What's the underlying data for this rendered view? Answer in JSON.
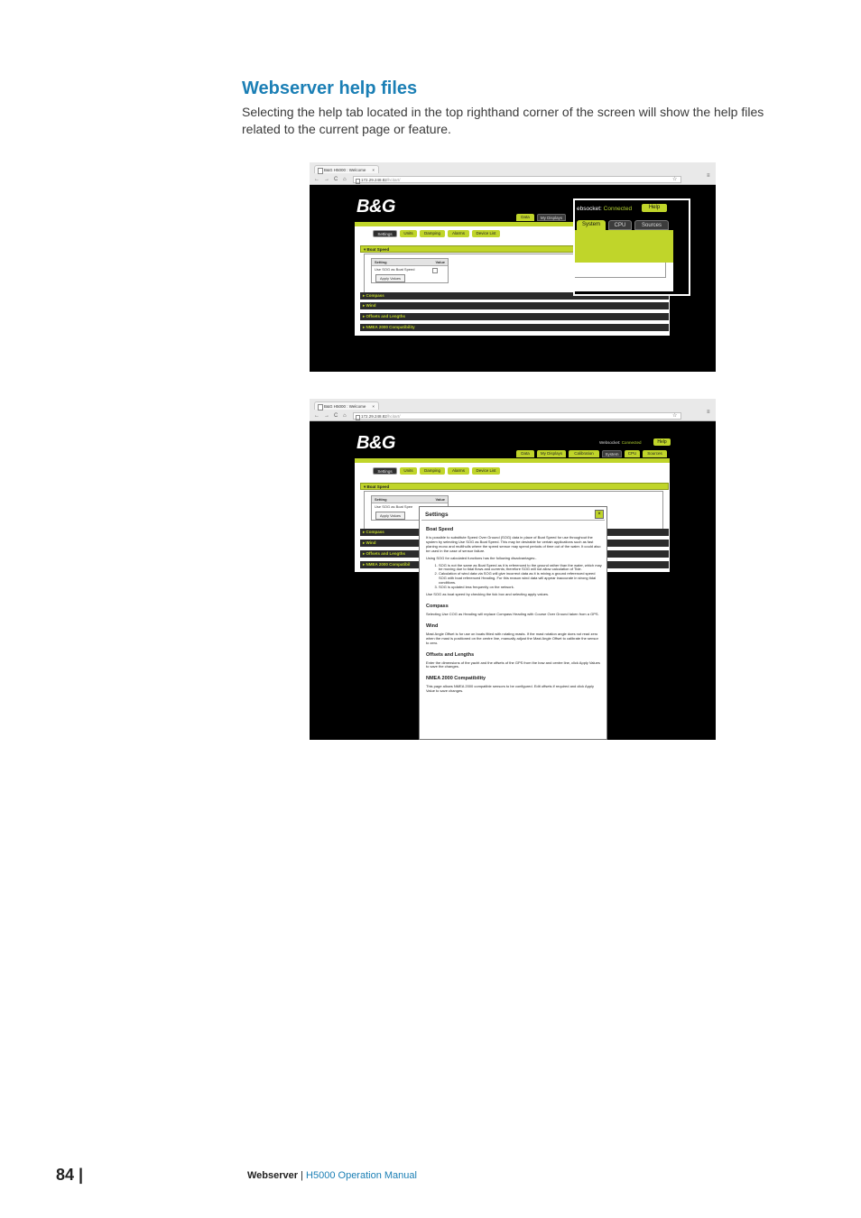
{
  "heading": "Webserver help files",
  "intro": "Selecting the help tab located in the top righthand corner of the screen will show the help files related to the current page or feature.",
  "browser": {
    "tab_title": "B&G H5000 : Welcome",
    "tab_close": "×",
    "back": "←",
    "forward": "→",
    "reload": "C",
    "home": "⌂",
    "star": "☆",
    "menu": "≡"
  },
  "shot1": {
    "url": "172.29.248.82",
    "url_tail": "/hcitart/",
    "logo": "B&G",
    "nav_tabs": [
      "Data",
      "My Displays"
    ],
    "settings_tabs": [
      "Settings",
      "Units",
      "Damping",
      "Alarms",
      "Device List"
    ],
    "sections": [
      "Boat Speed",
      "Compass",
      "Wind",
      "Offsets and Lengths",
      "NMEA 2000 Compatibility"
    ],
    "table": {
      "col1": "Setting",
      "col2": "Value",
      "row1": "Use SOG as Boat Speed",
      "apply": "Apply Values"
    },
    "popup": {
      "ws_label": "ebsocket: ",
      "ws_status": "Connected",
      "help": "Help",
      "tabs": [
        "System",
        "CPU",
        "Sources"
      ]
    }
  },
  "shot2": {
    "url": "172.29.248.82",
    "url_tail": "/hcitart/",
    "logo": "B&G",
    "ws_label": "Websocket: ",
    "ws_status": "Connected",
    "help": "Help",
    "nav_tabs": [
      "Data",
      "My Displays",
      "Calibration",
      "System",
      "CPU",
      "Sources"
    ],
    "settings_tabs": [
      "Settings",
      "Units",
      "Damping",
      "Alarms",
      "Device List"
    ],
    "sections": [
      "Boat Speed",
      "Compass",
      "Wind",
      "Offsets and Lengths",
      "NMEA 2000 Compatibil"
    ],
    "table": {
      "col1": "Setting",
      "col2": "Value",
      "row1": "Use SOG as Boat Spee",
      "apply": "Apply Values"
    },
    "modal": {
      "title": "Settings",
      "close": "×",
      "h_boat": "Boat Speed",
      "p1": "It is possible to substitute Speed Over Ground (SOG) data in place of Boat Speed for use throughout the system by selecting Use SOG as Boat Speed. This may be desirable for certain applications such as fast planing mono and multihulls where the speed sensor may spend periods of time out of the water. It could also be used in the case of sensor failure.",
      "p2": "Using SOG for calculated functions has the following disadvantages:-",
      "li1": "SOG is not the same as Boat Speed as it is referenced to the ground rather than the water, which may be moving due to tidal flows and currents; therefore SOG will not allow calculation of Tide.",
      "li2": "Calculation of wind data via SOG will give incorrect data as it is mixing a ground referenced speed SOG with boat referenced Heading. For this reason wind data will appear inaccurate in strong tidal conditions.",
      "li3": "SOG is updated less frequently on the network.",
      "p3": "Use SOG as boat speed by checking the tick box and selecting apply values.",
      "h_compass": "Compass",
      "p_compass": "Selecting Use COG as Heading will replace Compass Heading with Course Over Ground taken from a GPS.",
      "h_wind": "Wind",
      "p_wind": "Mast Angle Offset is for use on boats fitted with rotating masts. If the mast rotation angle does not read zero when the mast is positioned on the centre line, manually adjust the Mast Angle Offset to calibrate the sensor to zero.",
      "h_offsets": "Offsets and Lengths",
      "p_offsets": "Enter the dimensions of the yacht and the offsets of the GPS from the bow and centre line, click Apply Values to save the changes.",
      "h_nmea": "NMEA 2000 Compatibility",
      "p_nmea": "This page allows NMEA 2000 compatible sensors to be configured. Edit offsets if required and click Apply Value to save changes."
    }
  },
  "footer": {
    "page_number": "84 |",
    "section": "Webserver",
    "sep": " | ",
    "manual": "H5000 Operation Manual"
  }
}
